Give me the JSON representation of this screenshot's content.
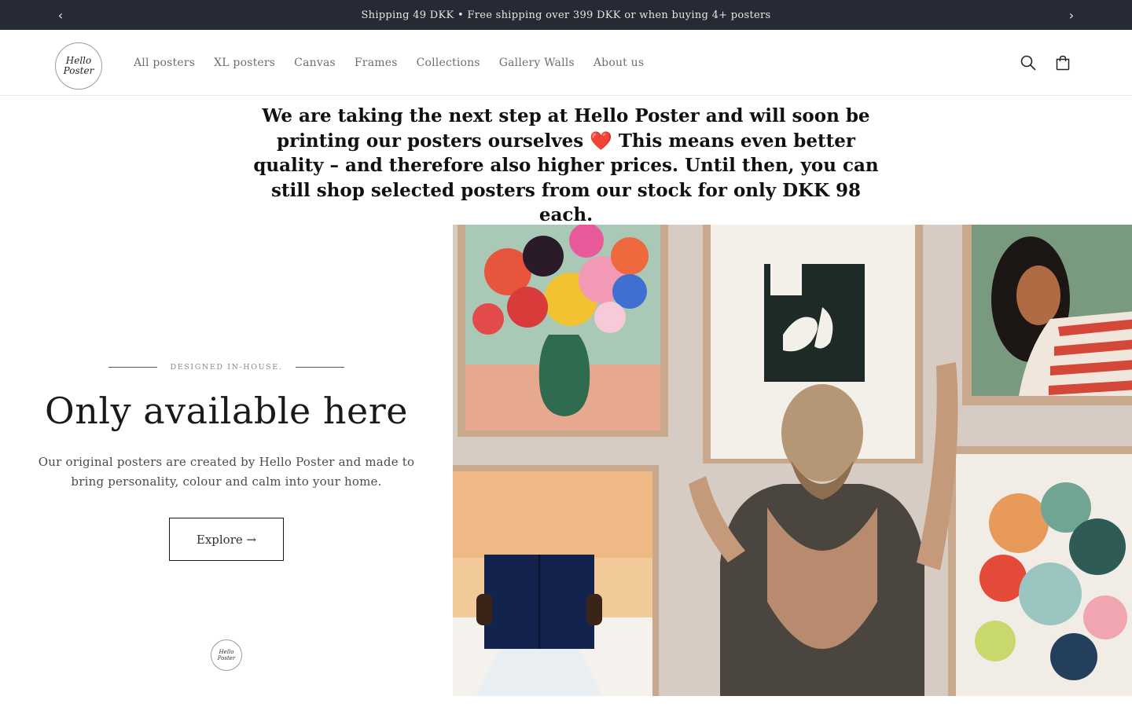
{
  "announcement": {
    "text": "Shipping 49 DKK • Free shipping over 399 DKK or when buying 4+ posters",
    "prev_icon": "chevron-left-icon",
    "next_icon": "chevron-right-icon",
    "prev_glyph": "‹",
    "next_glyph": "›"
  },
  "header": {
    "logo_line1": "Hello",
    "logo_line2": "Poster",
    "nav": [
      "All posters",
      "XL posters",
      "Canvas",
      "Frames",
      "Collections",
      "Gallery Walls",
      "About us"
    ],
    "search_icon": "search-icon",
    "cart_icon": "cart-icon"
  },
  "notice": {
    "text": "We are taking the next step at Hello Poster and will soon be printing our posters ourselves ❤️ This means even better quality – and therefore also higher prices. Until then, you can still shop selected posters from our stock for only DKK 98 each."
  },
  "hero": {
    "eyebrow": "DESIGNED IN-HOUSE.",
    "title": "Only available here",
    "text": "Our original posters are created by Hello Poster and made to bring personality, colour and calm into your home.",
    "button_label": "Explore →",
    "small_logo_line1": "Hello",
    "small_logo_line2": "Poster"
  },
  "colors": {
    "announcement_bg": "#252a35",
    "announcement_text": "#e9e6df",
    "nav_text": "#6e6e6e",
    "body_text": "#121212"
  }
}
